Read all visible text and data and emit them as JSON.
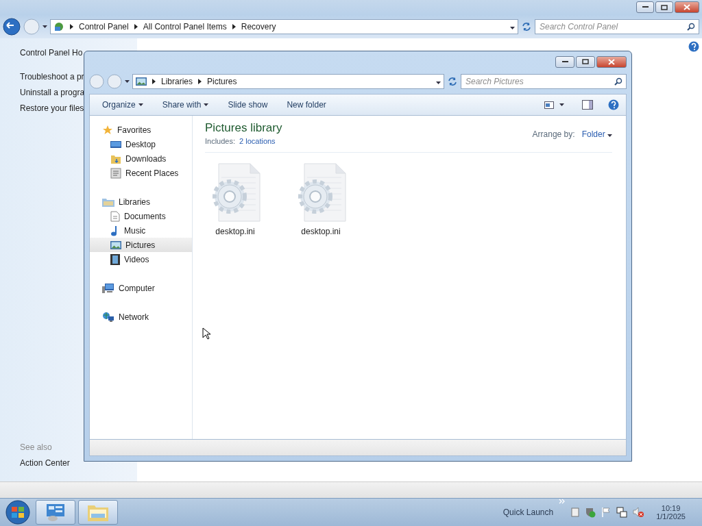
{
  "control_panel": {
    "breadcrumb": [
      "Control Panel",
      "All Control Panel Items",
      "Recovery"
    ],
    "search": {
      "placeholder": "Search Control Panel"
    },
    "links": [
      "Control Panel Ho",
      "Troubleshoot a pr",
      "Uninstall a progra",
      "Restore your files"
    ],
    "see_also": {
      "heading": "See also",
      "links": [
        "Action Center"
      ]
    }
  },
  "explorer": {
    "breadcrumb": [
      "Libraries",
      "Pictures"
    ],
    "search": {
      "placeholder": "Search Pictures"
    },
    "toolbar": [
      {
        "label": "Organize",
        "dropdown": true
      },
      {
        "label": "Share with",
        "dropdown": true
      },
      {
        "label": "Slide show",
        "dropdown": false
      },
      {
        "label": "New folder",
        "dropdown": false
      }
    ],
    "nav": [
      {
        "label": "Favorites",
        "kind": "star",
        "selected": false,
        "children": [
          {
            "label": "Desktop",
            "kind": "desktop",
            "selected": false
          },
          {
            "label": "Downloads",
            "kind": "downloads",
            "selected": false
          },
          {
            "label": "Recent Places",
            "kind": "recent",
            "selected": false
          }
        ]
      },
      {
        "label": "Libraries",
        "kind": "library",
        "selected": false,
        "children": [
          {
            "label": "Documents",
            "kind": "document",
            "selected": false
          },
          {
            "label": "Music",
            "kind": "music",
            "selected": false
          },
          {
            "label": "Pictures",
            "kind": "pictures",
            "selected": true
          },
          {
            "label": "Videos",
            "kind": "video",
            "selected": false
          }
        ]
      },
      {
        "label": "Computer",
        "kind": "computer",
        "selected": false
      },
      {
        "label": "Network",
        "kind": "network",
        "selected": false
      }
    ],
    "library": {
      "title": "Pictures library",
      "includes_label": "Includes:",
      "includes_link": "2 locations",
      "arrange_label": "Arrange by:",
      "arrange_value": "Folder"
    },
    "files": [
      {
        "name": "desktop.ini"
      },
      {
        "name": "desktop.ini"
      }
    ]
  },
  "taskbar": {
    "tasks": [
      {
        "kind": "control-panel"
      },
      {
        "kind": "explorer"
      }
    ],
    "quick_launch": "Quick Launch",
    "time": "10:19",
    "date": "1/1/2025"
  }
}
